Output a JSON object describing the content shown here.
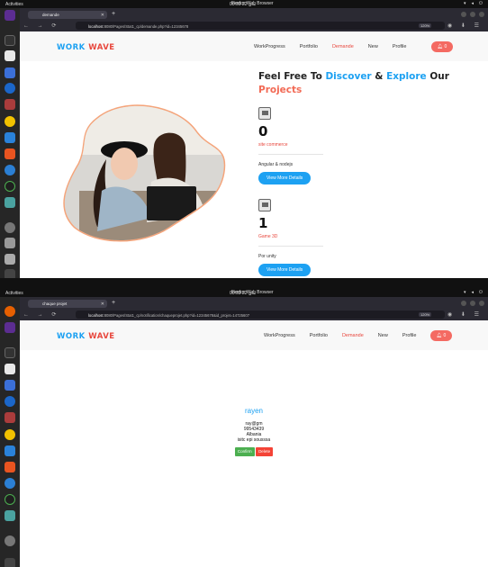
{
  "screen1": {
    "topbar": {
      "activities": "Activities",
      "clock": "00:00 22 ماي",
      "browser_name": "Firefox Web Browser"
    },
    "tab_label": "demande",
    "url_host": "localhost",
    "url_path": ":8080/Pages/Stat1_cp/demande.php?id=12345678",
    "zoom": "120%",
    "logo_word1": "WORK",
    "logo_word2": "WAVE",
    "menu": [
      "WorkProgress",
      "Portfolio",
      "Demande",
      "New",
      "Profile"
    ],
    "bell_count": "0",
    "heading": {
      "t1": "Feel Free To ",
      "t2": "Discover",
      "t3": " & ",
      "t4": "Explore",
      "t5": " Our",
      "t6": "Projects"
    },
    "cards": [
      {
        "number": "0",
        "name": "site commerce",
        "desc": "Angular & nodejs",
        "button": "View More Details"
      },
      {
        "number": "1",
        "name": "Game 3D",
        "desc": "Por unity",
        "button": "View More Details"
      }
    ]
  },
  "screen2": {
    "topbar": {
      "activities": "Activities",
      "clock": "00:03 22 ماي",
      "browser_name": "Firefox Web Browser"
    },
    "tab_label": "chaque projet",
    "url_host": "localhost",
    "url_path": ":8080/Pages/Stat1_cp/notification/chaqueprojet.php?id=12345678&id_projet=14725607",
    "zoom": "120%",
    "logo_word1": "WORK",
    "logo_word2": "WAVE",
    "menu": [
      "WorkProgress",
      "Portfolio",
      "Demande",
      "New",
      "Profile"
    ],
    "bell_count": "0",
    "detail": {
      "name": "rayen",
      "email": "ray@gm",
      "phone": "99543439",
      "country": "Albania",
      "school": "isitc epi sousssa",
      "confirm": "Confirm",
      "delete": "Delete"
    }
  },
  "colors": {
    "accent_blue": "#1da1f2",
    "accent_red": "#e8473d",
    "bell": "#f46a62",
    "confirm": "#4caf50",
    "delete": "#f44336"
  }
}
